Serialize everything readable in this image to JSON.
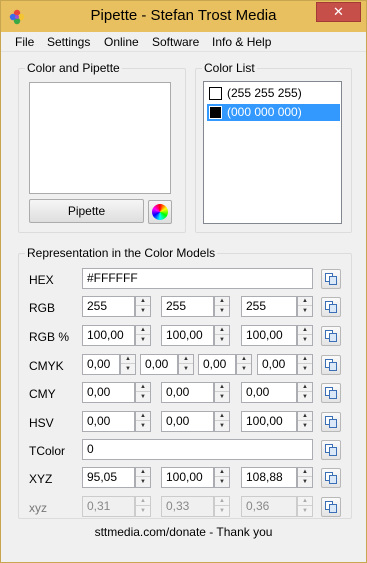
{
  "window": {
    "title": "Pipette - Stefan Trost Media",
    "close_glyph": "✕"
  },
  "menu": [
    "File",
    "Settings",
    "Online",
    "Software",
    "Info & Help"
  ],
  "color_and_pipette": {
    "label": "Color and Pipette",
    "pipette_button": "Pipette"
  },
  "color_list": {
    "label": "Color List",
    "items": [
      {
        "text": "(255 255 255)",
        "swatch": "#ffffff",
        "selected": false
      },
      {
        "text": "(000 000 000)",
        "swatch": "#000000",
        "selected": true
      }
    ]
  },
  "models": {
    "label": "Representation in the Color Models",
    "hex": {
      "label": "HEX",
      "value": "#FFFFFF"
    },
    "rgb": {
      "label": "RGB",
      "values": [
        "255",
        "255",
        "255"
      ]
    },
    "rgb_pct": {
      "label": "RGB %",
      "values": [
        "100,00",
        "100,00",
        "100,00"
      ]
    },
    "cmyk": {
      "label": "CMYK",
      "values": [
        "0,00",
        "0,00",
        "0,00",
        "0,00"
      ]
    },
    "cmy": {
      "label": "CMY",
      "values": [
        "0,00",
        "0,00",
        "0,00"
      ]
    },
    "hsv": {
      "label": "HSV",
      "values": [
        "0,00",
        "0,00",
        "100,00"
      ]
    },
    "tcolor": {
      "label": "TColor",
      "value": "0"
    },
    "xyz": {
      "label": "XYZ",
      "values": [
        "95,05",
        "100,00",
        "108,88"
      ]
    },
    "xyz_lower": {
      "label": "xyz",
      "values": [
        "0,31",
        "0,33",
        "0,36"
      ]
    }
  },
  "footer": "sttmedia.com/donate - Thank you",
  "colors": {
    "titlebar": "#e9c05f",
    "selection": "#3399ff",
    "close": "#c74f4a"
  }
}
